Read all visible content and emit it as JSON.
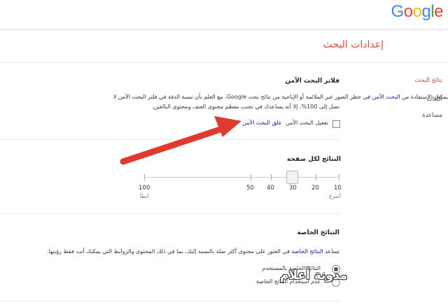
{
  "logo": {
    "letters": [
      "G",
      "o",
      "o",
      "g",
      "l",
      "e"
    ],
    "colors": [
      "#4285f4",
      "#ea4335",
      "#fbbc05",
      "#4285f4",
      "#34a853",
      "#ea4335"
    ]
  },
  "page_title": "إعدادات البحث",
  "sidebar": {
    "items": [
      {
        "label": "نتائج البحث",
        "active": true
      },
      {
        "label": "اللغات",
        "active": false
      },
      {
        "label": "مساعدة",
        "active": false
      }
    ]
  },
  "safesearch": {
    "title": "فلاتر البحث الآمن",
    "desc_line1_pre": "يمكنك الاستفادة من",
    "desc_link": "البحث الآمن",
    "desc_line1_post": "في حظر الصور غير الملائمة أو الإباحية من نتائج بحث Google، مع العلم بأن نسبة الدقة في فلتر البحث الآمن لا",
    "desc_line2": "تصل إلى 100%، إلا أنه يساعدك في تجنب معظم محتوى العنف ومحتوى البالغين.",
    "checkbox_label": "تفعيل البحث الآمن",
    "lock_link": "غلق البحث الآمن",
    "checked": false
  },
  "results_per_page": {
    "title": "النتائج لكل صفحة",
    "values": [
      10,
      20,
      30,
      40,
      50,
      100
    ],
    "selected": 30,
    "faster_label": "أسرع",
    "slower_label": "أبطأ"
  },
  "private_results": {
    "title": "النتائج الخاصة",
    "desc_pre": "تساعد",
    "desc_link": "النتائج الخاصة",
    "desc_post": "في العثور على محتوى أكثر صلة بالنسبة إليك، بما في ذلك المحتوى والروابط التي يمكنك أنت فقط رؤيتها.",
    "options": [
      {
        "label": "النتائج الخاصة بالمستخدم",
        "selected": true
      },
      {
        "label": "عدم استخدام النتائج الخاصة",
        "selected": false
      }
    ]
  },
  "watermark": "مدونة أعلام"
}
